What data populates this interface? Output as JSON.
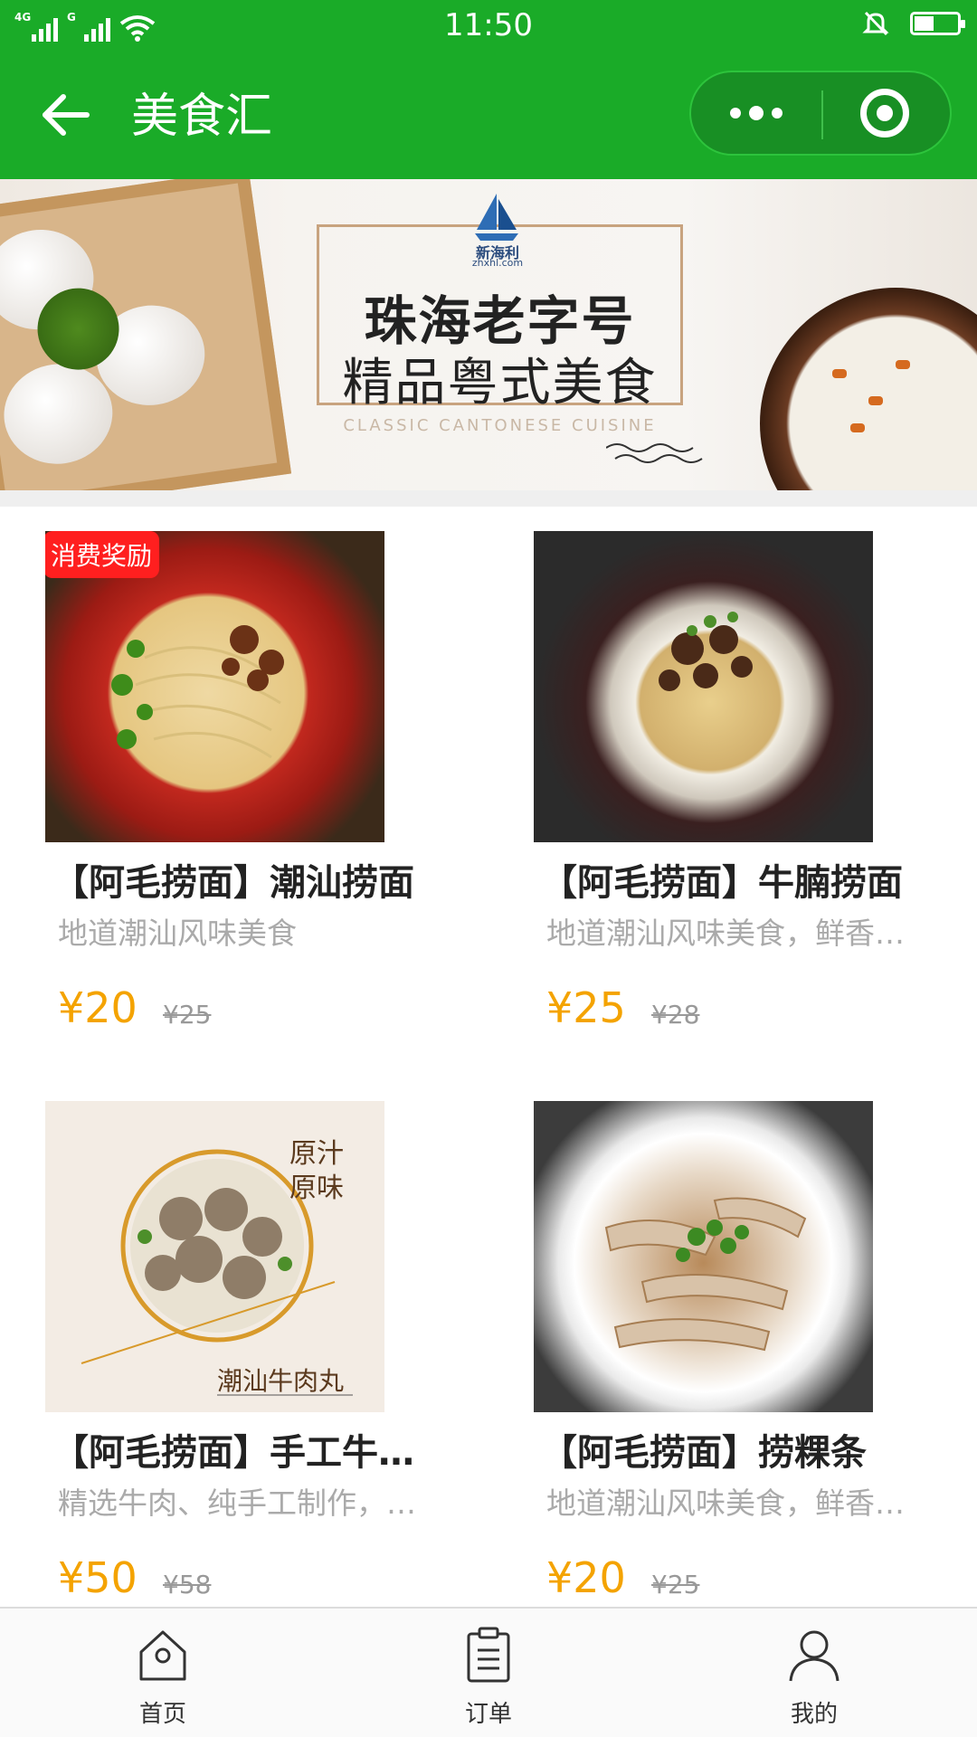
{
  "status_bar": {
    "time": "11:50",
    "network_1": "4G",
    "network_2": "G",
    "battery_level": 0.45
  },
  "nav": {
    "title": "美食汇"
  },
  "banner": {
    "brand": "新海利",
    "brand_url": "zhxhl.com",
    "line1": "珠海老字号",
    "line2": "精品粤式美食",
    "subtitle_en": "CLASSIC CANTONESE CUISINE"
  },
  "products": [
    {
      "name": "【阿毛捞面】潮汕捞面",
      "desc": "地道潮汕风味美食",
      "price": "¥20",
      "original_price": "¥25",
      "badge": "消费奖励"
    },
    {
      "name": "【阿毛捞面】牛腩捞面",
      "desc": "地道潮汕风味美食，鲜香…",
      "price": "¥25",
      "original_price": "¥28"
    },
    {
      "name": "【阿毛捞面】手工牛…",
      "desc": "精选牛肉、纯手工制作，…",
      "price": "¥50",
      "original_price": "¥58",
      "image_text_1": "原汁原味",
      "image_text_2": "潮汕牛肉丸"
    },
    {
      "name": "【阿毛捞面】捞粿条",
      "desc": "地道潮汕风味美食，鲜香…",
      "price": "¥20",
      "original_price": "¥25"
    }
  ],
  "tabbar": {
    "items": [
      {
        "label": "首页",
        "icon": "home-icon"
      },
      {
        "label": "订单",
        "icon": "order-icon"
      },
      {
        "label": "我的",
        "icon": "user-icon"
      }
    ]
  },
  "colors": {
    "primary_green": "#1aab28",
    "price_orange": "#f4a300",
    "badge_red": "#ff1f1f"
  }
}
